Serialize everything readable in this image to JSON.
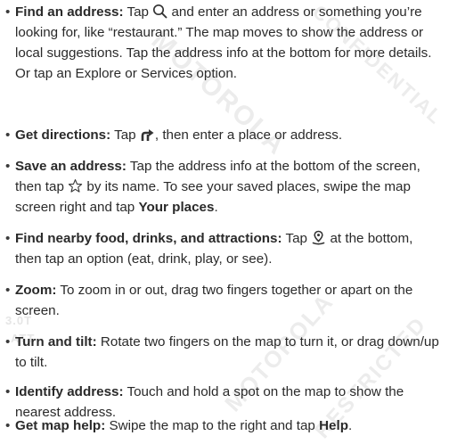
{
  "tips": [
    {
      "term": "Find an address:",
      "icon": "search-icon",
      "before": "Tap",
      "after": "and enter an address or something you’re looking for, like “restaurant.” The map moves to show the address or local suggestions. Tap the address info at the bottom for more details. Or tap an Explore or Services option."
    },
    {
      "term": "Get directions:",
      "icon": "directions-icon",
      "before": "Tap",
      "after": ", then enter a place or address."
    },
    {
      "term": "Save an address:",
      "text": "Tap the address info at the bottom of the screen, then tap",
      "icon": "star-icon",
      "after": "by its name. To see your saved places, swipe the map screen right and tap",
      "emphasis": "Your places",
      "end": "."
    },
    {
      "term": "Find nearby food, drinks, and attractions:",
      "before": "Tap",
      "icon": "explore-icon",
      "after": "at the bottom, then tap an option (eat, drink, play, or see)."
    },
    {
      "term": "Zoom:",
      "text": "To zoom in or out, drag two fingers together or apart on the screen."
    },
    {
      "term": "Turn and tilt:",
      "text": "Rotate two fingers on the map to turn it, or drag down/up to tilt."
    },
    {
      "term": "Identify address:",
      "text": "Touch and hold a spot on the map to show the nearest address."
    },
    {
      "term": "Get map help:",
      "text": "Swipe the map to the right and tap",
      "emphasis": "Help",
      "end": "."
    }
  ]
}
